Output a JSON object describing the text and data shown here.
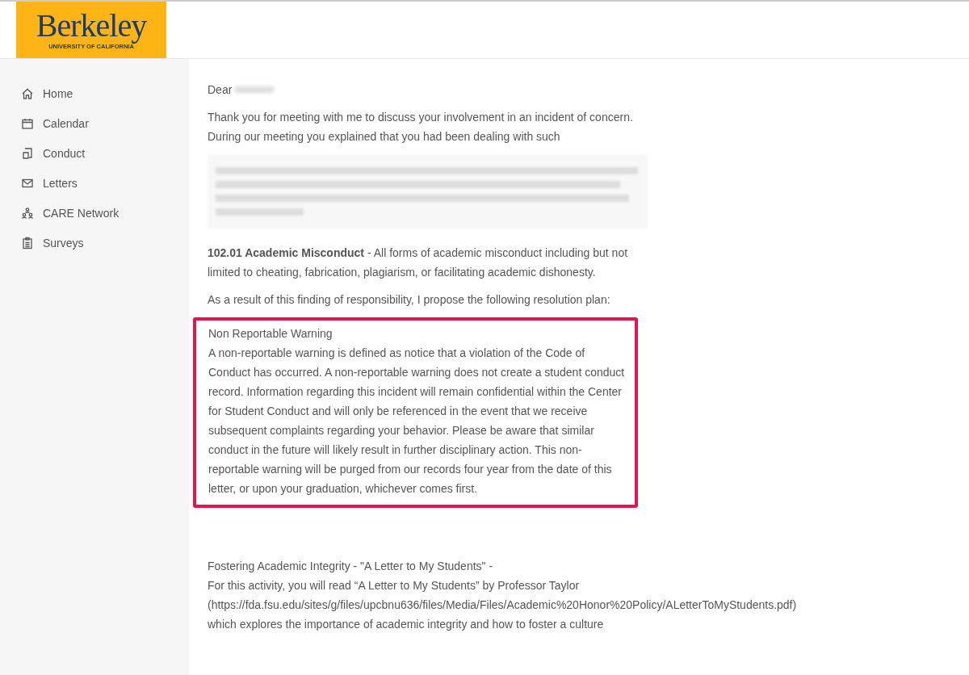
{
  "logo": {
    "wordmark": "Berkeley",
    "subtitle": "UNIVERSITY OF CALIFORNIA"
  },
  "sidebar": {
    "items": [
      {
        "label": "Home",
        "kind": "home"
      },
      {
        "label": "Calendar",
        "kind": "calendar"
      },
      {
        "label": "Conduct",
        "kind": "conduct"
      },
      {
        "label": "Letters",
        "kind": "letters"
      },
      {
        "label": "CARE Network",
        "kind": "network"
      },
      {
        "label": "Surveys",
        "kind": "surveys"
      }
    ]
  },
  "letter": {
    "greeting": "Dear",
    "intro": "Thank you for meeting with me to discuss your involvement in an incident of concern. During our meeting you explained that you had been dealing with such",
    "policy": "**102.01 Academic Misconduct** - All forms of academic misconduct including but not limited to cheating, fabrication, plagiarism, or facilitating academic dishonesty.",
    "resolution": "As a result of this finding of responsibility, I propose the following resolution plan:",
    "highlight": {
      "title": "Non Reportable Warning",
      "body": "A non-reportable warning is defined as notice that a violation of the Code of Conduct has occurred. A non-reportable warning does not create a student conduct record. Information regarding this incident will remain confidential within the Center for Student Conduct and will only be referenced in the event that we receive subsequent complaints regarding your behavior. Please be aware that similar conduct in the future will likely result in further disciplinary action. This non-reportable warning will be purged from our records four year from the date of this letter, or upon your graduation, whichever comes first."
    },
    "activity": [
      "Fostering Academic Integrity - \"A Letter to My Students\" -",
      "For this activity, you will read “A Letter to My Students” by Professor Taylor",
      "(https://fda.fsu.edu/sites/g/files/upcbnu636/files/Media/Files/Academic%20Honor%20Policy/ALetterToMyStudents.pdf)",
      "which explores the importance of academic integrity and how to foster a culture"
    ]
  }
}
